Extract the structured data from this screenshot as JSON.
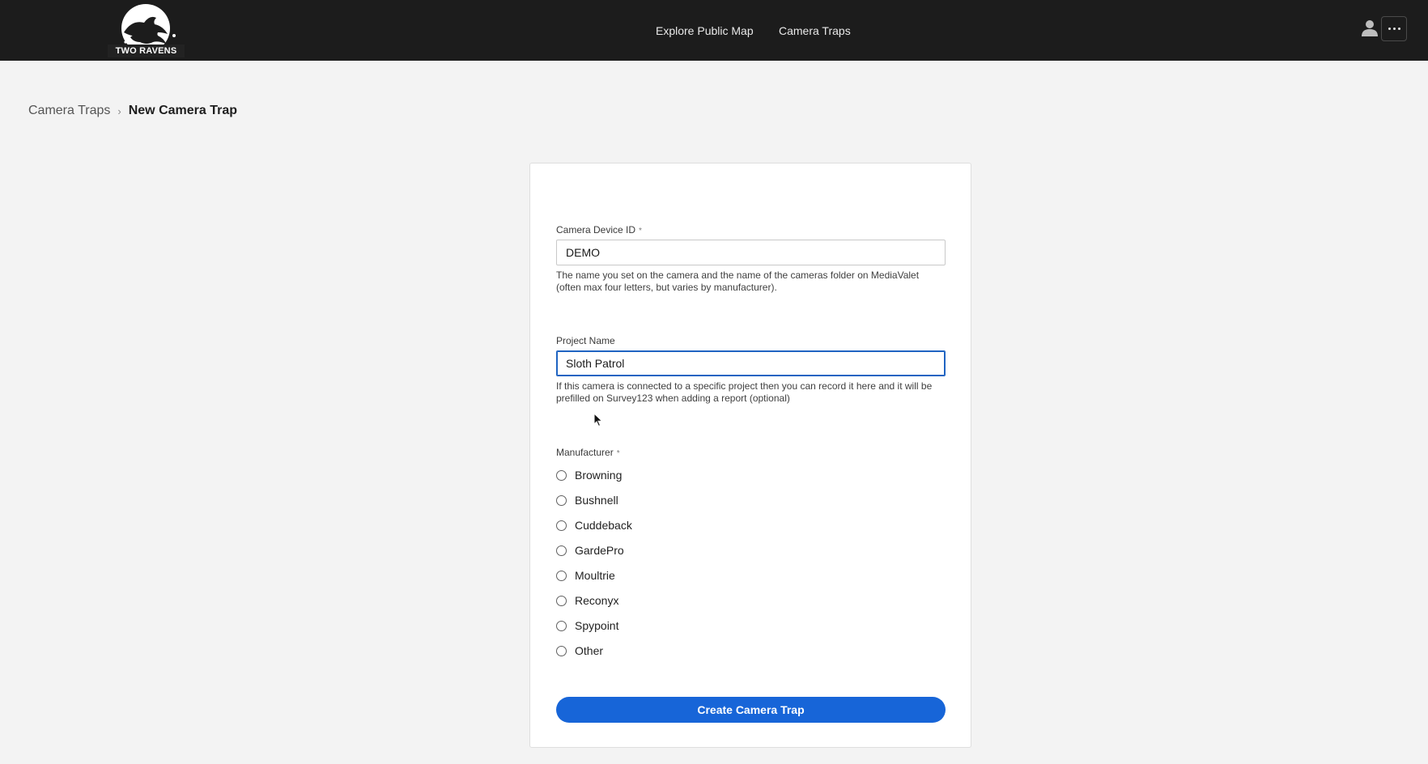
{
  "header": {
    "logo_text": "TWO RAVENS",
    "nav": [
      {
        "label": "Explore Public Map"
      },
      {
        "label": "Camera Traps"
      }
    ],
    "user_icon": "user-icon",
    "more_icon": "more-horizontal-icon"
  },
  "breadcrumb": {
    "parent": "Camera Traps",
    "current": "New Camera Trap"
  },
  "form": {
    "device_id": {
      "label": "Camera Device ID",
      "required_mark": "*",
      "value": "DEMO",
      "help": "The name you set on the camera and the name of the cameras folder on MediaValet (often max four letters, but varies by manufacturer)."
    },
    "project": {
      "label": "Project Name",
      "value": "Sloth Patrol",
      "help": "If this camera is connected to a specific project then you can record it here and it will be prefilled on Survey123 when adding a report (optional)"
    },
    "manufacturer": {
      "label": "Manufacturer",
      "required_mark": "*",
      "options": [
        "Browning",
        "Bushnell",
        "Cuddeback",
        "GardePro",
        "Moultrie",
        "Reconyx",
        "Spypoint",
        "Other"
      ],
      "selected": null
    },
    "submit_label": "Create Camera Trap"
  },
  "colors": {
    "header_bg": "#1c1c1c",
    "page_bg": "#f3f3f3",
    "primary": "#1765d8",
    "focus": "#1f64c2"
  }
}
